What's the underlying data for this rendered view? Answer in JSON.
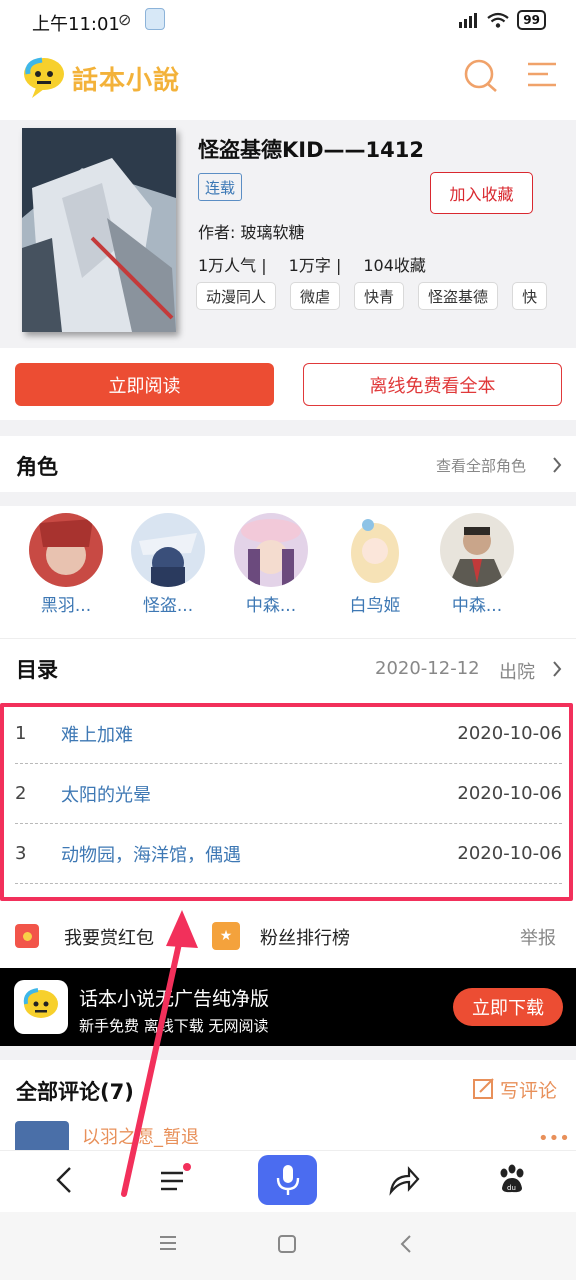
{
  "status_bar": {
    "time": "上午11:01",
    "battery": "99"
  },
  "header": {
    "app_name": "話本小說",
    "search_icon": "search-icon",
    "menu_icon": "menu-icon"
  },
  "book": {
    "title": "怪盗基德KID——1412",
    "status_badge": "连载",
    "favorite_label": "加入收藏",
    "author": "作者: 玻璃软糖",
    "stats": [
      "1万人气 |",
      "1万字 |",
      "104收藏"
    ],
    "tags": [
      "动漫同人",
      "微虐",
      "快青",
      "怪盗基德",
      "快"
    ]
  },
  "actions": {
    "read_label": "立即阅读",
    "offline_label": "离线免费看全本"
  },
  "characters": {
    "title": "角色",
    "see_all": "查看全部角色",
    "items": [
      {
        "name": "黑羽..."
      },
      {
        "name": "怪盗..."
      },
      {
        "name": "中森..."
      },
      {
        "name": "白鸟姬"
      },
      {
        "name": "中森..."
      }
    ]
  },
  "toc": {
    "title": "目录",
    "latest_date": "2020-12-12",
    "latest_chapter": "出院",
    "chapters": [
      {
        "num": "1",
        "title": "难上加难",
        "date": "2020-10-06"
      },
      {
        "num": "2",
        "title": "太阳的光晕",
        "date": "2020-10-06"
      },
      {
        "num": "3",
        "title": "动物园，海洋馆，偶遇",
        "date": "2020-10-06"
      }
    ]
  },
  "reward_row": {
    "reward": "我要赏红包",
    "fans": "粉丝排行榜",
    "report": "举报"
  },
  "ad": {
    "title": "话本小说无广告纯净版",
    "subtitle": "新手免费 离线下载 无网阅读",
    "button": "立即下载"
  },
  "comments": {
    "title": "全部评论(7)",
    "write_label": "写评论",
    "first_user": "以羽之愿_暂退"
  },
  "colors": {
    "accent_red": "#ec4d33",
    "link_blue": "#3e78b4",
    "highlight_pink": "#f2305b",
    "logo_yellow": "#f3b23a"
  }
}
